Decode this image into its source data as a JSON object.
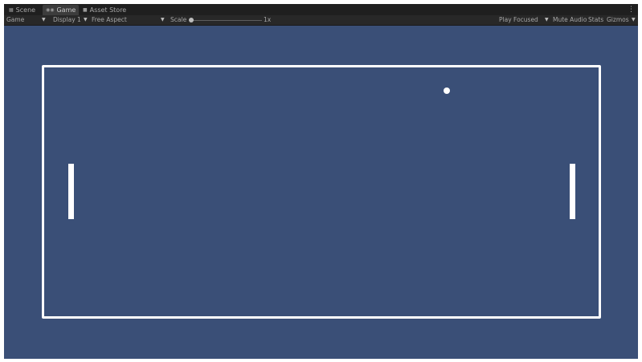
{
  "tabs": [
    {
      "label": "Scene",
      "icon": "grid-icon",
      "glyph": "▦",
      "active": false
    },
    {
      "label": "Game",
      "icon": "gamepad-icon",
      "glyph": "◉◉",
      "active": true
    },
    {
      "label": "Asset Store",
      "icon": "store-icon",
      "glyph": "■",
      "active": false
    }
  ],
  "tab_menu_glyph": "⋮",
  "toolbar": {
    "view_select": "Game",
    "display_select": "Display 1",
    "aspect_select": "Free Aspect",
    "scale_label": "Scale",
    "scale_value": "1x",
    "play_mode_select": "Play Focused",
    "mute_audio": "Mute Audio",
    "stats": "Stats",
    "gizmos": "Gizmos",
    "caret": "▼"
  },
  "game": {
    "background_color": "#3a4f77",
    "foreground_color": "#ffffff"
  }
}
